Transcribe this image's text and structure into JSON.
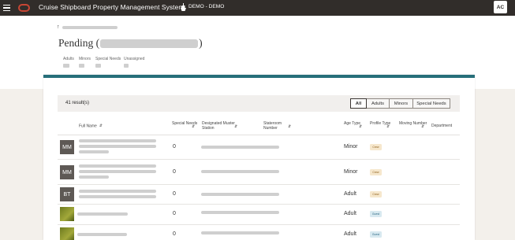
{
  "topbar": {
    "app_title": "Cruise Shipboard Property Management System",
    "ship_label": "DEMO - DEMO",
    "user_initials": "AC",
    "icons": [
      "hamburger-menu-icon",
      "oracle-logo-icon",
      "ship-icon"
    ]
  },
  "header": {
    "title_prefix": "Pending (",
    "title_suffix": ")",
    "counts": [
      "Adults",
      "Minors",
      "Special Needs",
      "Unassigned"
    ]
  },
  "toolbar": {
    "results": "41 result(s)",
    "filters": [
      "All",
      "Adults",
      "Minors",
      "Special Needs"
    ],
    "active_filter": "All"
  },
  "table": {
    "columns": [
      "Full Name",
      "Special Needs",
      "Designated Muster Station",
      "Stateroom Number",
      "Age Type",
      "Profile Type",
      "Moving Number",
      "Department"
    ],
    "rows": [
      {
        "initials": "MM",
        "special_needs": "0",
        "age_type": "Minor",
        "profile_type": "Crew"
      },
      {
        "initials": "MM",
        "special_needs": "0",
        "age_type": "Minor",
        "profile_type": "Crew"
      },
      {
        "initials": "BT",
        "special_needs": "0",
        "age_type": "Adult",
        "profile_type": "Crew"
      },
      {
        "initials": "",
        "special_needs": "0",
        "age_type": "Adult",
        "profile_type": "Guest"
      },
      {
        "initials": "",
        "special_needs": "0",
        "age_type": "Adult",
        "profile_type": "Guest"
      }
    ]
  },
  "colors": {
    "topbar": "#312d2a",
    "accent": "#276f7a",
    "crew_badge_bg": "#f6e7cc",
    "crew_badge_text": "#8a5a14",
    "guest_badge_bg": "#d8e9f0",
    "guest_badge_text": "#2f6a85"
  }
}
